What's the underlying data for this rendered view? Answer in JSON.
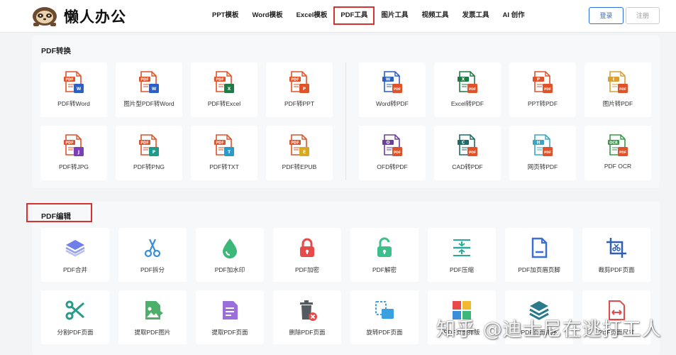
{
  "header": {
    "logo_text": "懒人办公",
    "nav": [
      "PPT模板",
      "Word模板",
      "Excel模板",
      "PDF工具",
      "图片工具",
      "视频工具",
      "发票工具",
      "AI 创作"
    ],
    "active_nav_index": 3,
    "login_label": "登录",
    "register_label": "注册"
  },
  "pdf_convert": {
    "title": "PDF转换",
    "items": [
      {
        "label": "PDF转Word",
        "badge": "W",
        "badge_color": "#2b5fc4",
        "type": "from-pdf"
      },
      {
        "label": "图片型PDF转Word",
        "badge": "W",
        "badge_color": "#2b5fc4",
        "type": "from-pdf"
      },
      {
        "label": "PDF转Excel",
        "badge": "X",
        "badge_color": "#1f7a45",
        "type": "from-pdf"
      },
      {
        "label": "PDF转PPT",
        "badge": "P",
        "badge_color": "#e0522a",
        "type": "from-pdf"
      },
      {
        "label": "Word转PDF",
        "badge": "W",
        "badge_color": "#2b5fc4",
        "type": "to-pdf"
      },
      {
        "label": "Excel转PDF",
        "badge": "X",
        "badge_color": "#1f7a45",
        "type": "to-pdf"
      },
      {
        "label": "PPT转PDF",
        "badge": "P",
        "badge_color": "#e0522a",
        "type": "to-pdf"
      },
      {
        "label": "图片转PDF",
        "badge": "I",
        "badge_color": "#d9a036",
        "type": "to-pdf"
      },
      {
        "label": "PDF转JPG",
        "badge": "J",
        "badge_color": "#7a3fb8",
        "type": "from-pdf"
      },
      {
        "label": "PDF转PNG",
        "badge": "P",
        "badge_color": "#1f9a8a",
        "type": "from-pdf"
      },
      {
        "label": "PDF转TXT",
        "badge": "T",
        "badge_color": "#2a9ac9",
        "type": "from-pdf"
      },
      {
        "label": "PDF转EPUB",
        "badge": "E",
        "badge_color": "#d9a820",
        "type": "from-pdf"
      },
      {
        "label": "OFD转PDF",
        "badge": "O",
        "badge_color": "#6a3fa0",
        "type": "to-pdf"
      },
      {
        "label": "CAD转PDF",
        "badge": "C",
        "badge_color": "#1d6a6a",
        "type": "to-pdf"
      },
      {
        "label": "网页转PDF",
        "badge": "H",
        "badge_color": "#3aa8c4",
        "type": "to-pdf"
      },
      {
        "label": "PDF OCR",
        "badge": "OCR",
        "badge_color": "#3a9a4a",
        "type": "to-pdf"
      }
    ]
  },
  "pdf_edit": {
    "title": "PDF编辑",
    "items": [
      {
        "label": "PDF合并",
        "icon": "layers-icon",
        "color": "#6f7ee8"
      },
      {
        "label": "PDF拆分",
        "icon": "scissors-icon",
        "color": "#3a8fd9"
      },
      {
        "label": "PDF加水印",
        "icon": "droplet-icon",
        "color": "#3cb878"
      },
      {
        "label": "PDF加密",
        "icon": "lock-icon",
        "color": "#e84a4a"
      },
      {
        "label": "PDF解密",
        "icon": "unlock-icon",
        "color": "#3cbf8a"
      },
      {
        "label": "PDF压缩",
        "icon": "compress-icon",
        "color": "#2aa89a"
      },
      {
        "label": "PDF加页眉页脚",
        "icon": "document-icon",
        "color": "#3a6fd9"
      },
      {
        "label": "裁剪PDF页面",
        "icon": "crop-icon",
        "color": "#2f5fb0"
      },
      {
        "label": "分割PDF页面",
        "icon": "split-scissors-icon",
        "color": "#2a9a8a"
      },
      {
        "label": "提取PDF图片",
        "icon": "image-extract-icon",
        "color": "#4caf6a"
      },
      {
        "label": "提取PDF页面",
        "icon": "page-extract-icon",
        "color": "#9a6fd9"
      },
      {
        "label": "删除PDF页面",
        "icon": "trash-icon",
        "color": "#555a60"
      },
      {
        "label": "旋转PDF页面",
        "icon": "rotate-icon",
        "color": "#3aa0e0"
      },
      {
        "label": "PDF页面排版",
        "icon": "puzzle-icon",
        "color": "#e84a4a"
      },
      {
        "label": "PDF页面排序",
        "icon": "stack-icon",
        "color": "#2a7a8a"
      },
      {
        "label": "PDF页面尺寸",
        "icon": "resize-icon",
        "color": "#e84a4a"
      }
    ]
  },
  "watermark_text": "知乎 @迪士尼在逃打工人"
}
